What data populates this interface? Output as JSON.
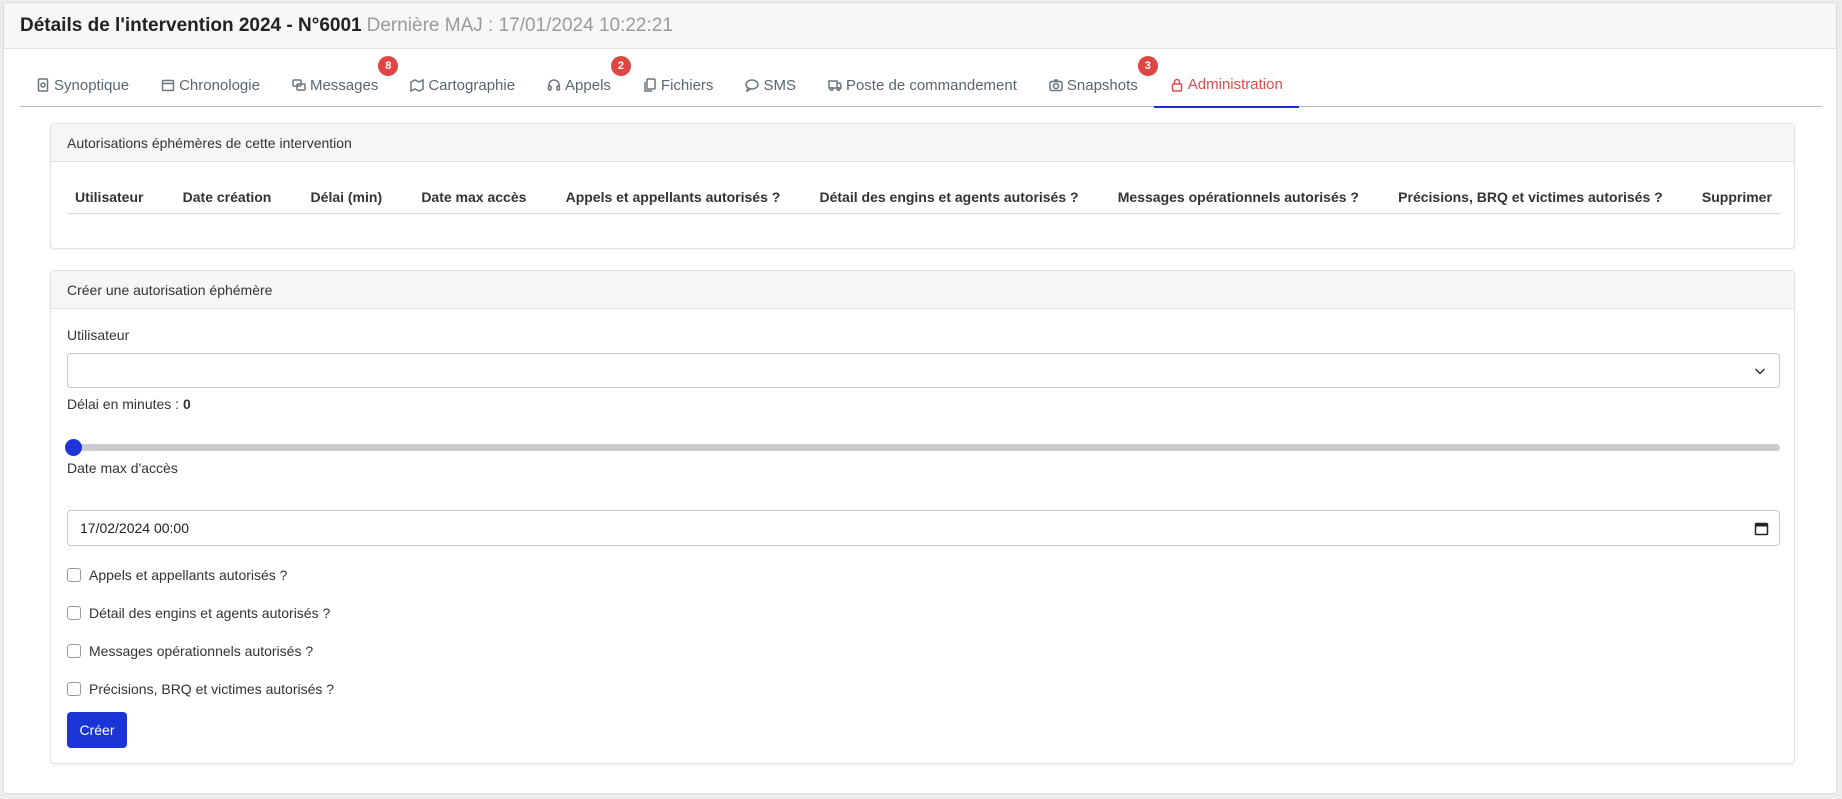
{
  "header": {
    "title": "Détails de l'intervention 2024 - N°6001",
    "subtitle": "Dernière MAJ : 17/01/2024 10:22:21"
  },
  "tabs": [
    {
      "label": "Synoptique",
      "icon": "file-icon",
      "badge": ""
    },
    {
      "label": "Chronologie",
      "icon": "calendar-icon",
      "badge": ""
    },
    {
      "label": "Messages",
      "icon": "chat-icon",
      "badge": "8"
    },
    {
      "label": "Cartographie",
      "icon": "map-icon",
      "badge": ""
    },
    {
      "label": "Appels",
      "icon": "headset-icon",
      "badge": "2"
    },
    {
      "label": "Fichiers",
      "icon": "files-icon",
      "badge": ""
    },
    {
      "label": "SMS",
      "icon": "sms-icon",
      "badge": ""
    },
    {
      "label": "Poste de commandement",
      "icon": "truck-icon",
      "badge": ""
    },
    {
      "label": "Snapshots",
      "icon": "camera-icon",
      "badge": "3"
    },
    {
      "label": "Administration",
      "icon": "lock-icon",
      "badge": "",
      "active": true
    }
  ],
  "authorizations_card": {
    "title": "Autorisations éphémères de cette intervention",
    "columns": [
      "Utilisateur",
      "Date création",
      "Délai (min)",
      "Date max accès",
      "Appels et appellants autorisés ?",
      "Détail des engins et agents autorisés ?",
      "Messages opérationnels autorisés ?",
      "Précisions, BRQ et victimes autorisés ?",
      "Supprimer"
    ]
  },
  "create_card": {
    "title": "Créer une autorisation éphémère",
    "user_label": "Utilisateur",
    "user_value": "",
    "delay_label": "Délai en minutes :",
    "delay_value": "0",
    "date_label": "Date max d'accès",
    "date_value": "17/02/2024 00:00",
    "checkboxes": [
      {
        "label": "Appels et appellants autorisés ?",
        "checked": false
      },
      {
        "label": "Détail des engins et agents autorisés ?",
        "checked": false
      },
      {
        "label": "Messages opérationnels autorisés ?",
        "checked": false
      },
      {
        "label": "Précisions, BRQ et victimes autorisés ?",
        "checked": false
      }
    ],
    "submit_label": "Créer"
  },
  "colors": {
    "accent_blue": "#1a34d6",
    "active_tab_red": "#e04b4b",
    "badge_red": "#e04545"
  }
}
